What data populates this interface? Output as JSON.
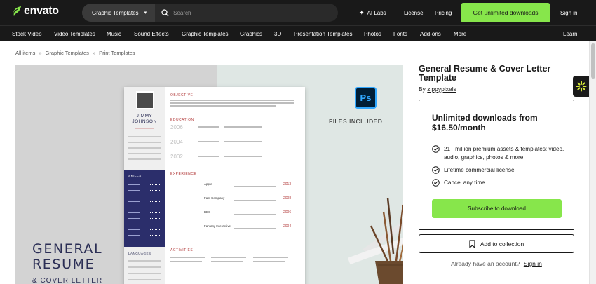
{
  "brand": {
    "name": "envato",
    "accent": "#87e64b",
    "bg": "#191919"
  },
  "search": {
    "category": "Graphic Templates",
    "placeholder": "Search"
  },
  "topnav": {
    "ai_labs": "AI Labs",
    "license": "License",
    "pricing": "Pricing",
    "cta": "Get unlimited downloads",
    "sign_in": "Sign in"
  },
  "categories": [
    "Stock Video",
    "Video Templates",
    "Music",
    "Sound Effects",
    "Graphic Templates",
    "Graphics",
    "3D",
    "Presentation Templates",
    "Photos",
    "Fonts",
    "Add-ons",
    "More"
  ],
  "learn": "Learn",
  "breadcrumb": [
    "All items",
    "Graphic Templates",
    "Print Templates"
  ],
  "preview": {
    "title_lines": [
      "GENERAL",
      "RESUME"
    ],
    "subtitle": "& COVER LETTER",
    "files_included": "FILES INCLUDED",
    "ps_badge": "Ps",
    "doc": {
      "first_name": "JIMMY",
      "last_name": "JOHNSON",
      "sections": [
        "OBJECTIVE",
        "EDUCATION",
        "EXPERIENCE",
        "ACTIVITIES"
      ],
      "sidebar_sections": [
        "SKILLS",
        "LANGUAGES"
      ],
      "years_edu": [
        "2006",
        "2004",
        "2002"
      ],
      "years_exp": [
        "2013",
        "2008",
        "2006",
        "2004"
      ],
      "companies": [
        "Apple",
        "Fast Company",
        "BBC",
        "Fantasy Interactive"
      ]
    }
  },
  "product": {
    "title": "General Resume & Cover Letter Template",
    "by": "By",
    "author": "zippypixels"
  },
  "plan": {
    "title": "Unlimited downloads from $16.50/month",
    "features": [
      "21+ million premium assets & templates: video, audio, graphics, photos & more",
      "Lifetime commercial license",
      "Cancel any time"
    ],
    "subscribe": "Subscribe to download"
  },
  "collection": {
    "label": "Add to collection"
  },
  "account": {
    "prompt": "Already have an account?",
    "sign_in": "Sign in"
  }
}
